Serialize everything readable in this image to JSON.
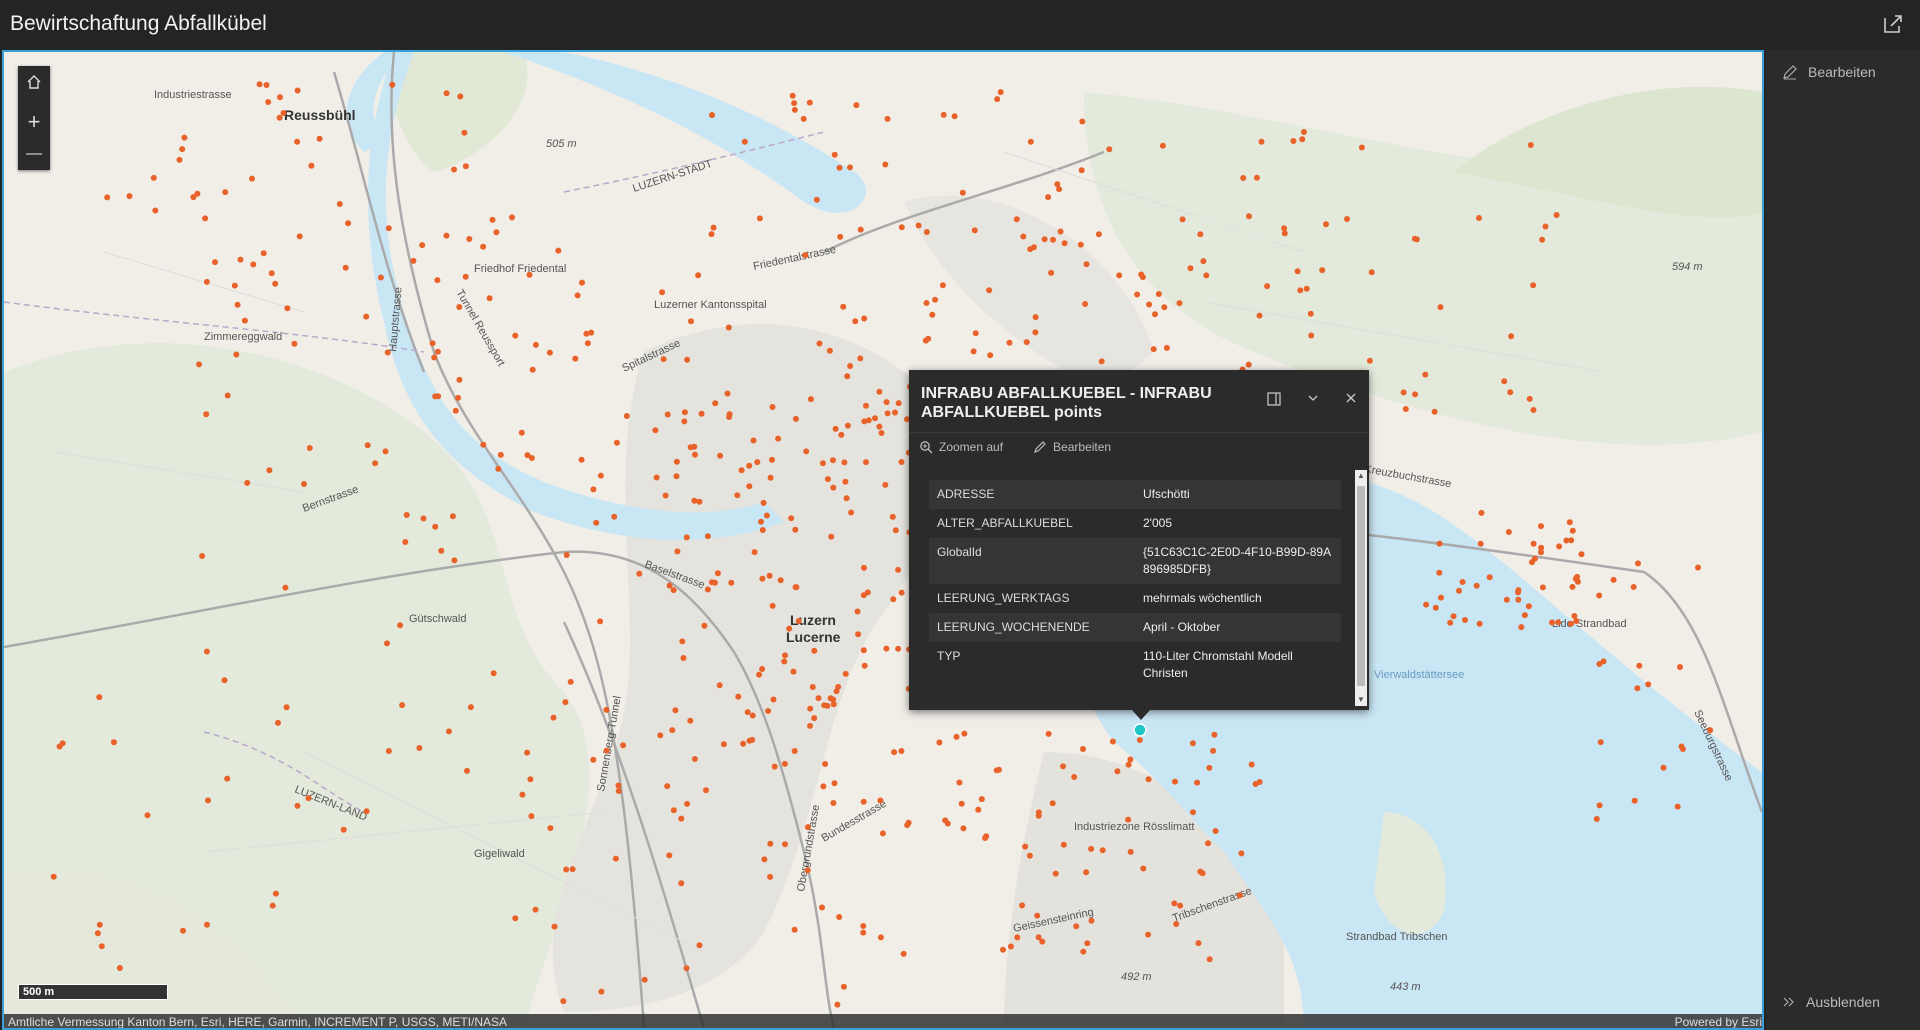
{
  "header": {
    "title": "Bewirtschaftung Abfallkübel"
  },
  "map": {
    "places": [
      {
        "text": "Reussbühl",
        "kind": "place"
      },
      {
        "text": "Luzern",
        "kind": "place"
      },
      {
        "text": "Lucerne",
        "kind": "place"
      },
      {
        "text": "Industriestrasse",
        "kind": "street"
      },
      {
        "text": "Luzerner Kantonsspital",
        "kind": "area"
      },
      {
        "text": "Friedhof Friedental",
        "kind": "area"
      },
      {
        "text": "Zimmereggwald",
        "kind": "area"
      },
      {
        "text": "Gütschwald",
        "kind": "area"
      },
      {
        "text": "Industriezone Rösslimatt",
        "kind": "area"
      },
      {
        "text": "Lido Strandbad",
        "kind": "area"
      },
      {
        "text": "Strandbad Tribschen",
        "kind": "area"
      },
      {
        "text": "Bernstrasse",
        "kind": "street"
      },
      {
        "text": "Baselstrasse",
        "kind": "street"
      },
      {
        "text": "Spitalstrasse",
        "kind": "street"
      },
      {
        "text": "Friedentalstrasse",
        "kind": "street"
      },
      {
        "text": "Kreuzbuchstrasse",
        "kind": "street"
      },
      {
        "text": "Seeburgstrasse",
        "kind": "street"
      },
      {
        "text": "Bundesstrasse",
        "kind": "street"
      },
      {
        "text": "Obergrundstrasse",
        "kind": "street"
      },
      {
        "text": "Hauptstrasse",
        "kind": "street"
      },
      {
        "text": "Tunnel Reussport",
        "kind": "street"
      },
      {
        "text": "Sonnenberg-Tunnel",
        "kind": "street"
      },
      {
        "text": "LUZERN-STADT",
        "kind": "boundary"
      },
      {
        "text": "LUZERN-LAND",
        "kind": "boundary"
      },
      {
        "text": "Gigeliwald",
        "kind": "area"
      },
      {
        "text": "Vierwaldstättersee",
        "kind": "water"
      },
      {
        "text": "Geissensteinring",
        "kind": "street"
      },
      {
        "text": "Tribschenstrasse",
        "kind": "street"
      },
      {
        "text": "505 m",
        "kind": "elevation"
      },
      {
        "text": "594 m",
        "kind": "elevation"
      },
      {
        "text": "492 m",
        "kind": "elevation"
      },
      {
        "text": "443 m",
        "kind": "elevation"
      }
    ],
    "scale_label": "500 m",
    "attribution_left": "Amtliche Vermessung Kanton Bern, Esri, HERE, Garmin, INCREMENT P, USGS, METI/NASA",
    "attribution_right": "Powered by Esri",
    "colors": {
      "water": "#c9e6f5",
      "land": "#f1eee8",
      "green": "#dfe8cf",
      "points": "#e8622a",
      "selected": "#21c7c7"
    }
  },
  "controls": {
    "home": "home-icon",
    "zoom_in": "+",
    "zoom_out": "—"
  },
  "popup": {
    "title": "INFRABU ABFALLKUEBEL - INFRABU ABFALLKUEBEL points",
    "zoom_label": "Zoomen auf",
    "edit_label": "Bearbeiten",
    "rows": [
      {
        "key": "ADRESSE",
        "value": "Ufschötti"
      },
      {
        "key": "ALTER_ABFALLKUEBEL",
        "value": "2'005"
      },
      {
        "key": "GlobalId",
        "value": "{51C63C1C-2E0D-4F10-B99D-89A896985DFB}"
      },
      {
        "key": "LEERUNG_WERKTAGS",
        "value": "mehrmals wöchentlich"
      },
      {
        "key": "LEERUNG_WOCHENENDE",
        "value": "April - Oktober"
      },
      {
        "key": "TYP",
        "value": "110-Liter Chromstahl Modell Christen"
      }
    ]
  },
  "side": {
    "edit_label": "Bearbeiten",
    "hide_label": "Ausblenden"
  }
}
